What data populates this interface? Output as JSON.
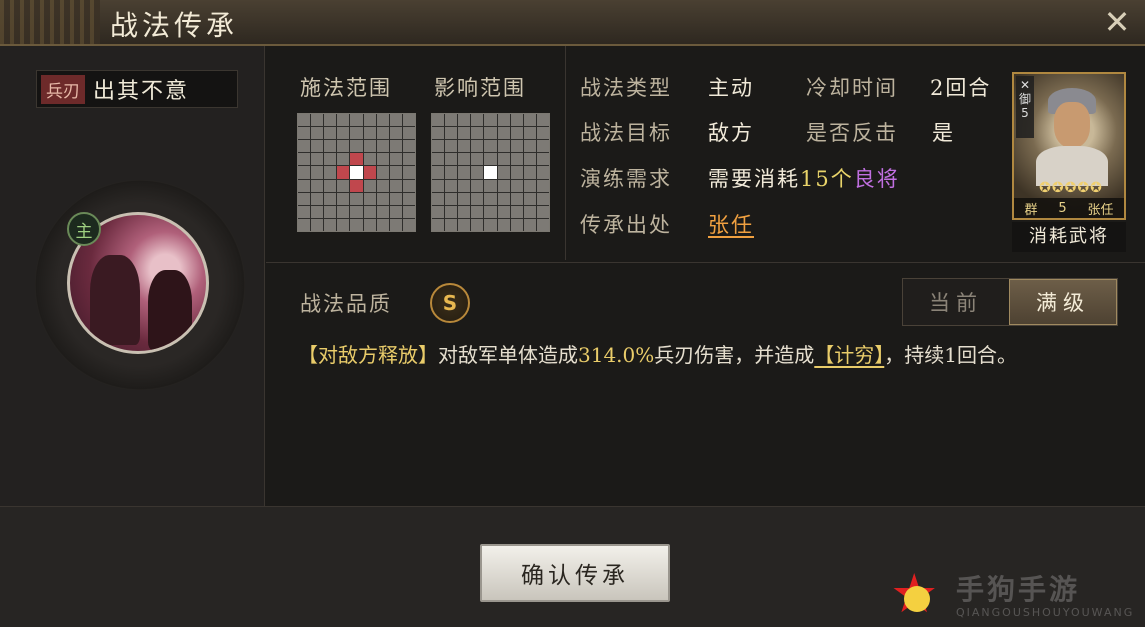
{
  "header": {
    "title": "战法传承"
  },
  "skill": {
    "tag": "兵刃",
    "name": "出其不意",
    "main_badge": "主"
  },
  "grids": {
    "cast_range_label": "施法范围",
    "effect_range_label": "影响范围"
  },
  "info": {
    "type_label": "战法类型",
    "type_value": "主动",
    "cooldown_label": "冷却时间",
    "cooldown_value": "2回合",
    "target_label": "战法目标",
    "target_value": "敌方",
    "counter_label": "是否反击",
    "counter_value": "是",
    "requirement_label": "演练需求",
    "requirement_prefix": "需要消耗",
    "requirement_count": "15个",
    "requirement_item": "良将",
    "source_label": "传承出处",
    "source_value": "张任"
  },
  "hero_card": {
    "side_text": "御",
    "side_num": "5",
    "stars": "✪✪✪✪✪",
    "faction": "群",
    "cost": "5",
    "name": "张任",
    "caption": "消耗武将"
  },
  "quality": {
    "label": "战法品质",
    "grade": "S"
  },
  "toggle": {
    "current": "当前",
    "max": "满级"
  },
  "description": {
    "tag": "【对敌方释放】",
    "p1": "对敌军单体造成",
    "percent": "314.0%",
    "p2": "兵刃伤害，并造成",
    "status": "【计穷】",
    "p3": "，持续",
    "turns": "1",
    "p4": "回合。"
  },
  "actions": {
    "confirm": "确认传承"
  },
  "watermark": {
    "text": "手狗手游",
    "sub": "QIANGOUSHOUYOUWANG"
  }
}
